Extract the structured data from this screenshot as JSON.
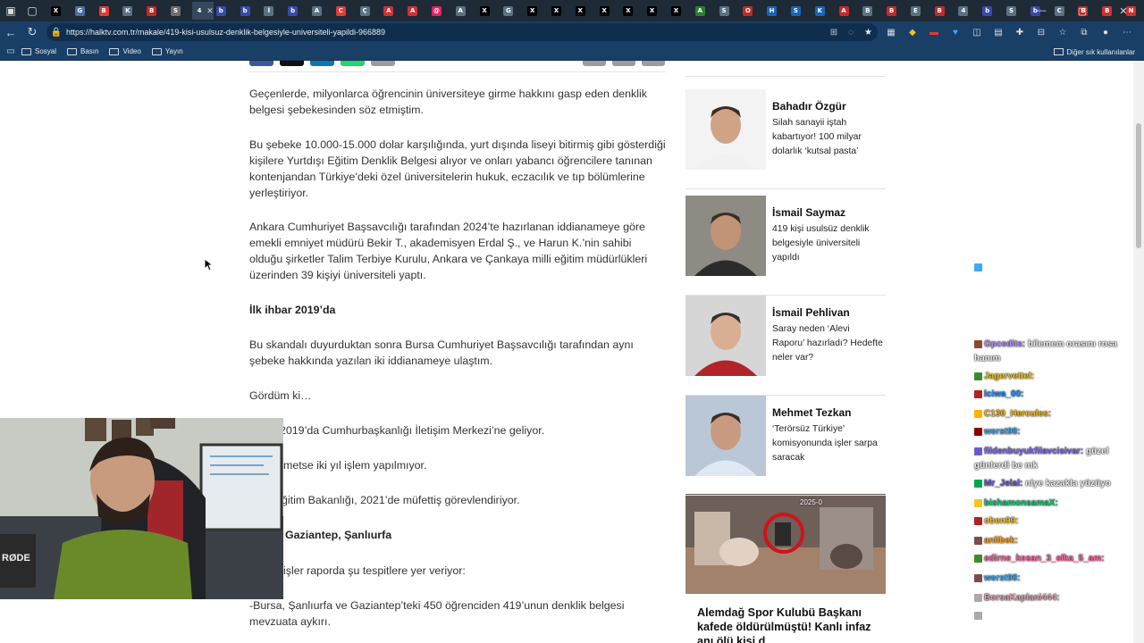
{
  "browser": {
    "url": "https://halktv.com.tr/makale/419-kisi-usulsuz-denklik-belgesiyle-universiteli-yapildi-966889",
    "tabs": [
      {
        "letter": "X",
        "color": "#000000"
      },
      {
        "letter": "G",
        "color": "#4a6fa5"
      },
      {
        "letter": "B",
        "color": "#e53935"
      },
      {
        "letter": "K",
        "color": "#5b6f85"
      },
      {
        "letter": "B",
        "color": "#c62828"
      },
      {
        "letter": "S",
        "color": "#6d6d6d"
      },
      {
        "letter": "4",
        "color": "#34485e"
      },
      {
        "letter": "b",
        "color": "#3949ab"
      },
      {
        "letter": "b",
        "color": "#3949ab"
      },
      {
        "letter": "İ",
        "color": "#5b6f85"
      },
      {
        "letter": "b",
        "color": "#3949ab"
      },
      {
        "letter": "A",
        "color": "#5b6f85"
      },
      {
        "letter": "C",
        "color": "#e53935"
      },
      {
        "letter": "Ç",
        "color": "#5b6f85"
      },
      {
        "letter": "A",
        "color": "#d32f2f"
      },
      {
        "letter": "A",
        "color": "#d32f2f"
      },
      {
        "letter": "@",
        "color": "#e91e63"
      },
      {
        "letter": "A",
        "color": "#5b6f85"
      },
      {
        "letter": "X",
        "color": "#000000"
      },
      {
        "letter": "G",
        "color": "#5b6f85"
      },
      {
        "letter": "X",
        "color": "#000000"
      },
      {
        "letter": "X",
        "color": "#000000"
      },
      {
        "letter": "X",
        "color": "#000000"
      },
      {
        "letter": "X",
        "color": "#000000"
      },
      {
        "letter": "X",
        "color": "#000000"
      },
      {
        "letter": "X",
        "color": "#000000"
      },
      {
        "letter": "X",
        "color": "#000000"
      },
      {
        "letter": "A",
        "color": "#2e7d32"
      },
      {
        "letter": "S",
        "color": "#5b6f85"
      },
      {
        "letter": "O",
        "color": "#c62828"
      },
      {
        "letter": "H",
        "color": "#1565c0"
      },
      {
        "letter": "S",
        "color": "#1565c0"
      },
      {
        "letter": "K",
        "color": "#1565c0"
      },
      {
        "letter": "A",
        "color": "#c62828"
      },
      {
        "letter": "B",
        "color": "#5b6f85"
      },
      {
        "letter": "B",
        "color": "#c62828"
      },
      {
        "letter": "E",
        "color": "#5b6f85"
      },
      {
        "letter": "B",
        "color": "#c62828"
      },
      {
        "letter": "4",
        "color": "#5b6f85"
      },
      {
        "letter": "b",
        "color": "#3949ab"
      },
      {
        "letter": "S",
        "color": "#5b6f85"
      },
      {
        "letter": "b",
        "color": "#3949ab"
      },
      {
        "letter": "C",
        "color": "#5b6f85"
      },
      {
        "letter": "B",
        "color": "#c62828"
      },
      {
        "letter": "B",
        "color": "#d32f2f"
      },
      {
        "letter": "N",
        "color": "#d32f2f"
      },
      {
        "letter": "Ş",
        "color": "#5b6f85"
      },
      {
        "letter": "@",
        "color": "#e91e63"
      },
      {
        "letter": "K",
        "color": "#5b6f85"
      },
      {
        "letter": "X",
        "color": "#000000"
      },
      {
        "letter": "G",
        "color": "#5b6f85"
      },
      {
        "letter": "X",
        "color": "#000000"
      },
      {
        "letter": "G",
        "color": "#5b6f85"
      },
      {
        "letter": "X",
        "color": "#000000"
      },
      {
        "letter": "G",
        "color": "#5b6f85"
      },
      {
        "letter": "▶",
        "color": "#e53935"
      },
      {
        "letter": "C",
        "color": "#5b6f85"
      }
    ],
    "active_tab_label": "4",
    "bookmarks": [
      "Sosyal",
      "Basın",
      "Video",
      "Yayın"
    ],
    "bookmarks_right": "Diğer sık kullanılanlar"
  },
  "article": {
    "paragraphs": [
      {
        "text": "Geçenlerde, milyonlarca öğrencinin üniversiteye girme hakkını gasp eden denklik belgesi şebekesinden söz etmiştim.",
        "bold": false
      },
      {
        "text": "Bu şebeke 10.000-15.000 dolar karşılığında, yurt dışında liseyi bitirmiş gibi gösterdiği kişilere Yurtdışı Eğitim Denklik Belgesi alıyor ve onları yabancı öğrencilere tanınan kontenjandan Türkiye’deki özel üniversitelerin hukuk, eczacılık ve tıp bölümlerine yerleştiriyor.",
        "bold": false
      },
      {
        "text": "Ankara Cumhuriyet Başsavcılığı tarafından 2024’te hazırlanan iddianameye göre emekli emniyet müdürü Bekir T., akademisyen Erdal Ş., ve Harun K.’nin sahibi olduğu şirketler Talim Terbiye Kurulu, Ankara ve Çankaya milli eğitim müdürlükleri üzerinden 39 kişiyi üniversiteli yaptı.",
        "bold": false
      },
      {
        "text": "İlk ihbar 2019’da",
        "bold": true
      },
      {
        "text": "Bu skandalı duyurduktan sonra Bursa Cumhuriyet Başsavcılığı tarafından aynı şebeke hakkında yazılan iki iddianameye ulaştım.",
        "bold": false
      },
      {
        "text": "Gördüm ki…",
        "bold": false
      },
      {
        "text": "2019’da Cumhurbaşkanlığı İletişim Merkezi’ne geliyor.",
        "bold": false
      },
      {
        "text": "metse iki yıl işlem yapılmıyor.",
        "bold": false
      },
      {
        "text": "ğitim Bakanlığı, 2021’de müfettiş görevlendiriyor.",
        "bold": false
      },
      {
        "text": "Gaziantep, Şanlıurfa",
        "bold": true
      },
      {
        "text": "işler raporda şu tespitlere yer veriyor:",
        "bold": false
      },
      {
        "text": "-Bursa, Şanlıurfa ve Gaziantep’teki 450 öğrenciden 419’unun denklik belgesi mevzuata aykırı.",
        "bold": false
      }
    ]
  },
  "sidebar": {
    "authors": [
      {
        "name": "",
        "title": "…, …"
      },
      {
        "name": "Bahadır Özgür",
        "title": "Silah sanayii iştah kabartıyor! 100 milyar dolarlık ‘kutsal pasta’"
      },
      {
        "name": "İsmail Saymaz",
        "title": "419 kişi usulsüz denklik belgesiyle üniversiteli yapıldı"
      },
      {
        "name": "İsmail Pehlivan",
        "title": "Saray neden ‘Alevi Raporu’ hazırladı? Hedefte neler var?"
      },
      {
        "name": "Mehmet Tezkan",
        "title": "‘Terörsüz Türkiye’ komisyonunda işler sarpa saracak"
      }
    ],
    "news_date": "2025-0",
    "news_title": "Alemdağ Spor Kulubü Başkanı kafede öldürülmüştü! Kanlı infaz anı ölü kişi d..."
  },
  "chat": [
    {
      "user": "",
      "msg": "",
      "color": "#9be29b"
    },
    {
      "user": "Gpcedits:",
      "msg": "bilemem orasını rosa hanım",
      "color": "#b08bff"
    },
    {
      "user": "Jagervettel:",
      "msg": "",
      "color": "#f0c419"
    },
    {
      "user": "lciwa_00:",
      "msg": "",
      "color": "#1e90ff"
    },
    {
      "user": "C130_Hercules:",
      "msg": "",
      "color": "#ffb300"
    },
    {
      "user": "werst98:",
      "msg": "",
      "color": "#3fa9f5"
    },
    {
      "user": "fildenbuyukfilavcisivar:",
      "msg": "güzel günlerdi be mk",
      "color": "#7b68ee"
    },
    {
      "user": "Mr_Jelal:",
      "msg": "niye kazakla yüzüyo",
      "color": "#6a5acd"
    },
    {
      "user": "bishamonsamaX:",
      "msg": "",
      "color": "#00d26a"
    },
    {
      "user": "oben99:",
      "msg": "",
      "color": "#f7c325"
    },
    {
      "user": "anlibek:",
      "msg": "",
      "color": "#ff9f1a"
    },
    {
      "user": "edirne_kesan_3_elka_5_am:",
      "msg": "",
      "color": "#ff5fa2"
    },
    {
      "user": "werst98:",
      "msg": "",
      "color": "#3fa9f5"
    },
    {
      "user": "BorsaKaplani444:",
      "msg": "",
      "color": "#e0a0b0"
    },
    {
      "user": "",
      "msg": "",
      "color": "#cccccc"
    }
  ]
}
